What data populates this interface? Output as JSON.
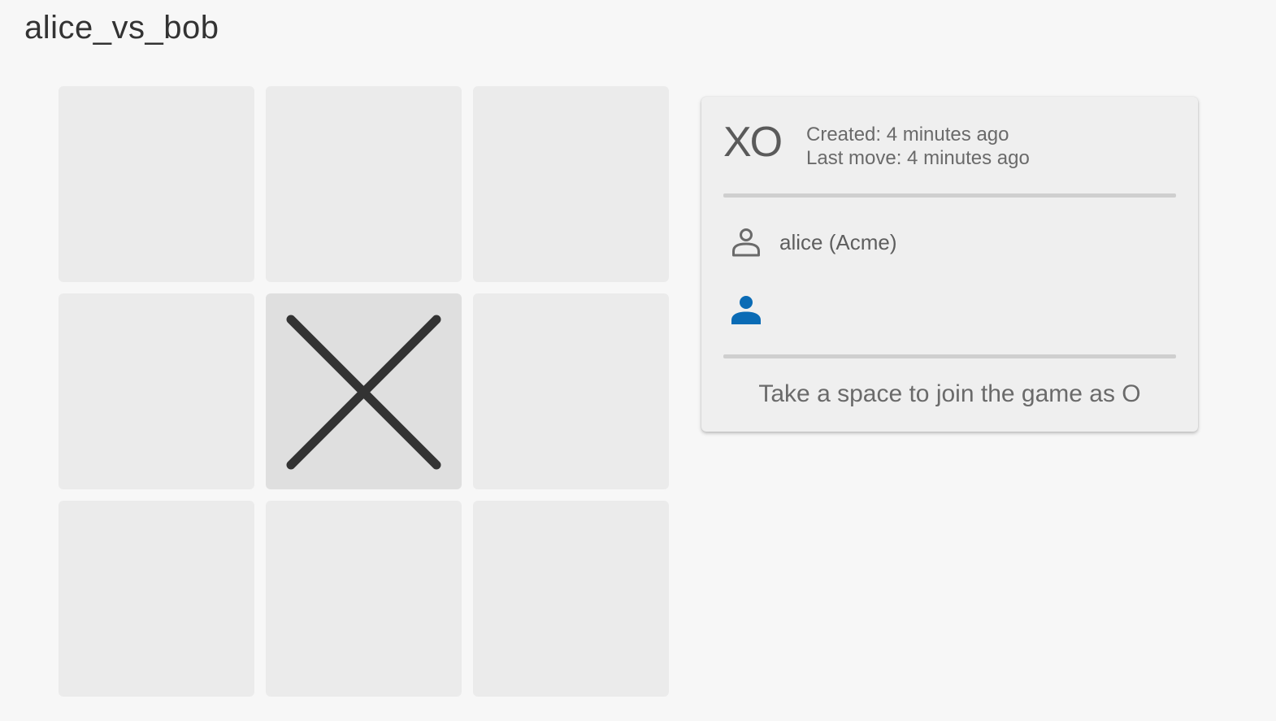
{
  "game": {
    "title": "alice_vs_bob"
  },
  "board": {
    "cells": [
      "",
      "",
      "",
      "",
      "X",
      "",
      "",
      "",
      ""
    ],
    "mark_color": "#333333",
    "empty_cell_color": "#ebebeb",
    "taken_cell_color": "#dfdfdf"
  },
  "info": {
    "logo": "XO",
    "created": "Created: 4 minutes ago",
    "last_move": "Last move: 4 minutes ago",
    "players": [
      {
        "name": "alice (Acme)",
        "icon": "person-outline-icon",
        "color": "#6a6a6a"
      },
      {
        "name": "",
        "icon": "person-filled-icon",
        "color": "#0a6bb5"
      }
    ],
    "join_hint": "Take a space to join the game as O"
  }
}
